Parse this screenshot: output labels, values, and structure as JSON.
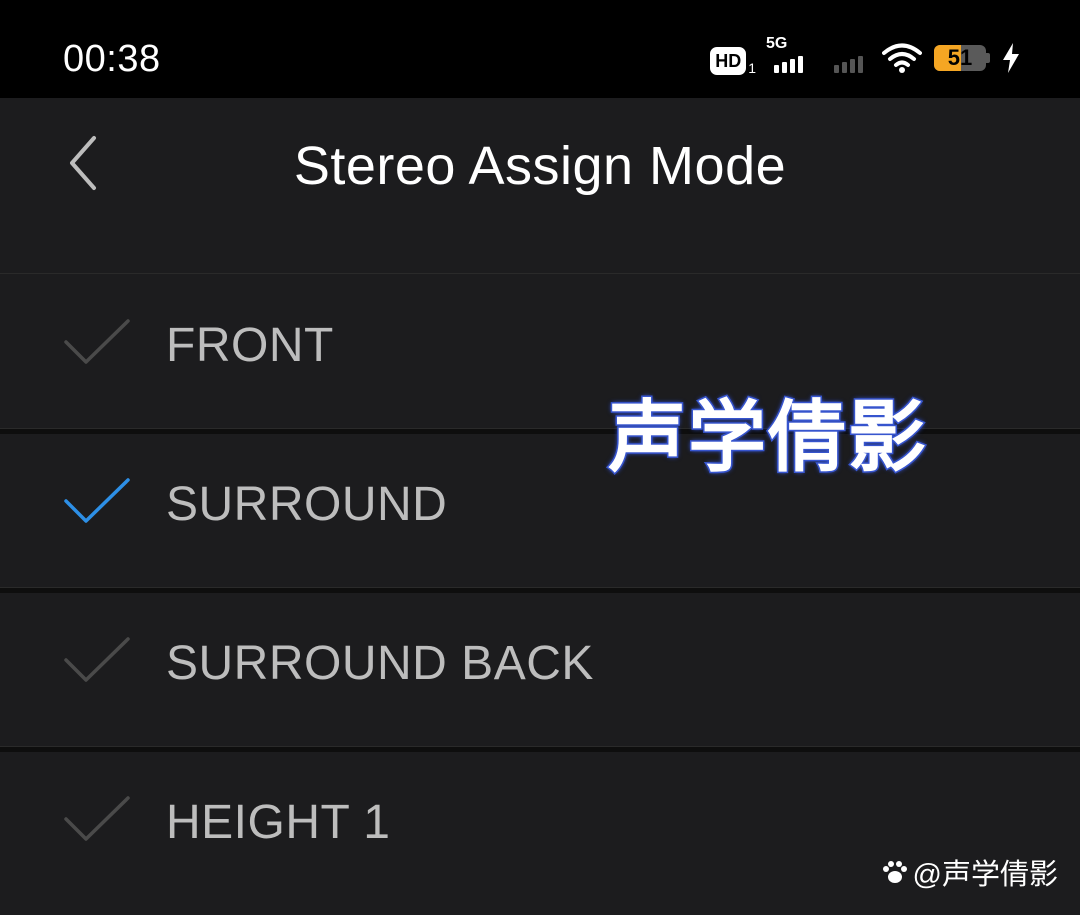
{
  "status_bar": {
    "time": "00:38",
    "hd_label": "HD",
    "hd_sub": "1",
    "network": "5G",
    "battery_level": "51",
    "battery_percent": 51,
    "icons": [
      "hd-icon",
      "signal-icon",
      "signal-icon",
      "wifi-icon",
      "battery-icon",
      "charging-icon"
    ]
  },
  "nav": {
    "title": "Stereo Assign Mode",
    "back_icon": "chevron-left-icon"
  },
  "options": [
    {
      "label": "FRONT",
      "selected": false
    },
    {
      "label": "SURROUND",
      "selected": true
    },
    {
      "label": "SURROUND BACK",
      "selected": false
    },
    {
      "label": "HEIGHT 1",
      "selected": false
    }
  ],
  "colors": {
    "background": "#1c1c1e",
    "status_bar": "#000000",
    "check_selected": "#2d8fe6",
    "check_unselected": "#4a4a4a",
    "label_text": "#bdbdbd",
    "battery_fill": "#f5a623"
  },
  "watermark": {
    "main_text": "声学倩影",
    "handle": "@声学倩影",
    "icon": "paw-icon"
  }
}
